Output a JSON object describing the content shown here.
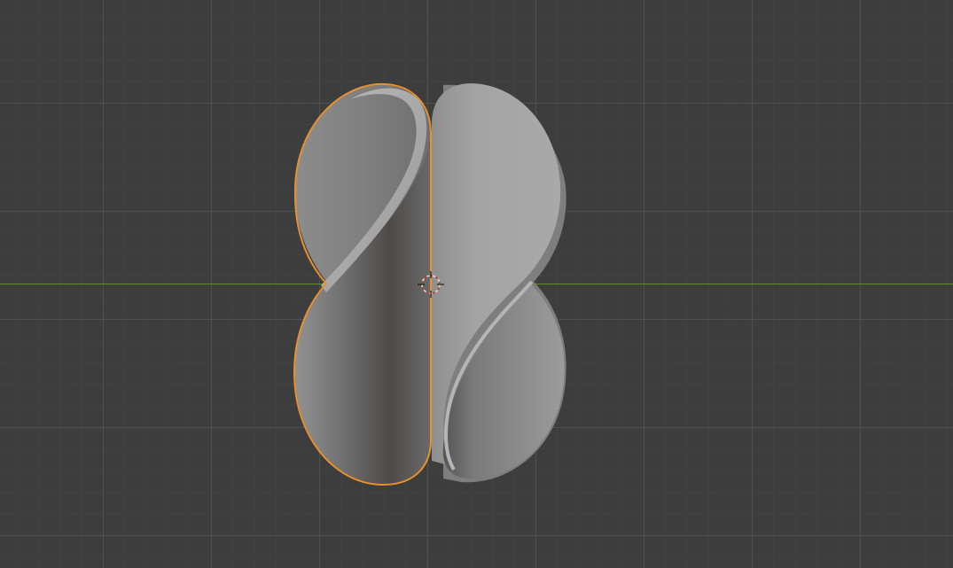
{
  "app": {
    "name": "",
    "view": "3d-viewport"
  },
  "viewport": {
    "background_color": "#3d3d3d",
    "grid_color": "#505050",
    "subgrid_color": "#424242",
    "x_axis_color": "#6a8a2e"
  },
  "scene": {
    "objects": [
      {
        "name": "",
        "selected": true,
        "outline_color": "#e8912d"
      },
      {
        "name": "",
        "selected": false
      }
    ],
    "cursor_icon": "3d-cursor-icon",
    "cursor_colors": [
      "#d9d9d9",
      "#c0392b"
    ]
  }
}
